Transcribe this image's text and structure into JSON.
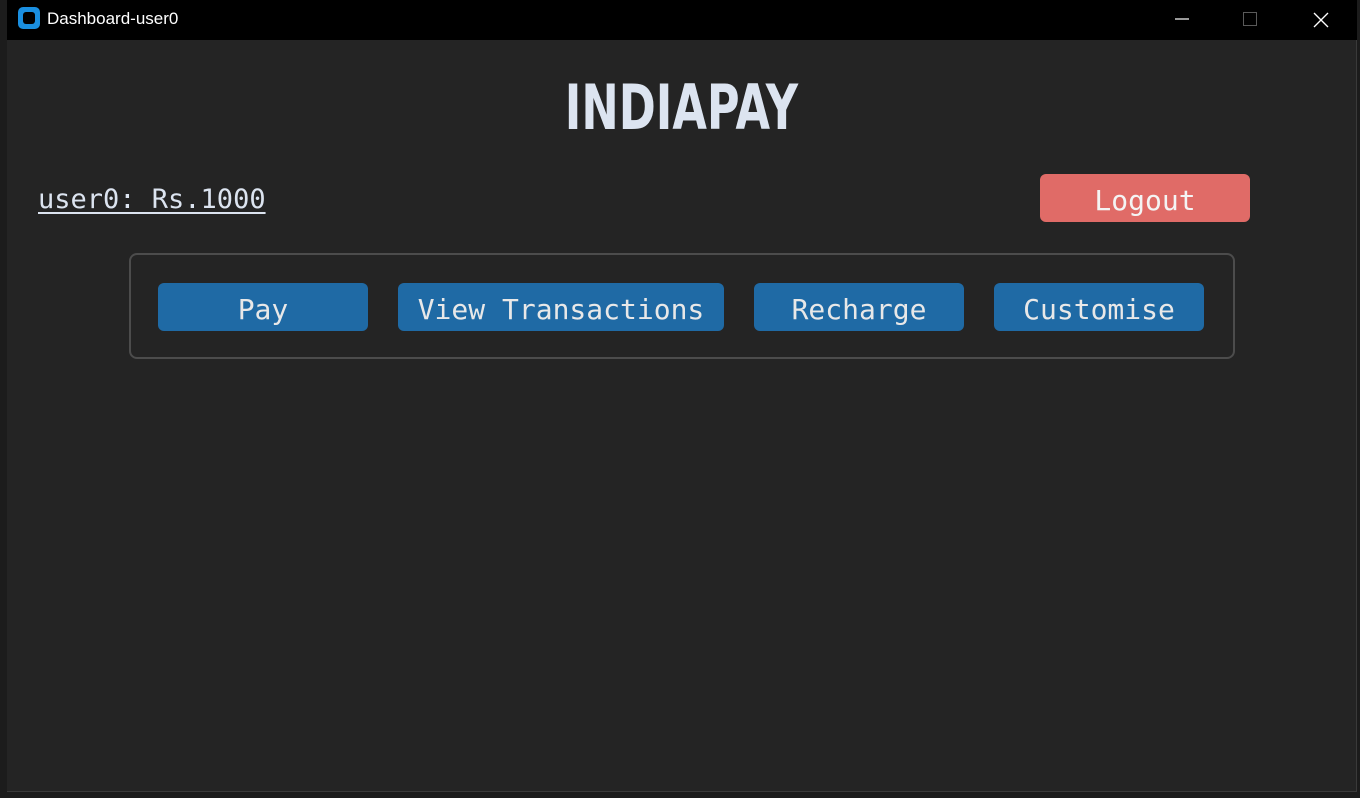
{
  "window": {
    "title": "Dashboard-user0",
    "icon": "app-icon",
    "controls": [
      "minimize-icon",
      "maximize-icon",
      "close-icon"
    ]
  },
  "header": {
    "brand": "INDIAPAY"
  },
  "account": {
    "balance_text": "user0: Rs.1000"
  },
  "actions": {
    "logout_label": "Logout",
    "pay_label": "Pay",
    "view_transactions_label": "View Transactions",
    "recharge_label": "Recharge",
    "customise_label": "Customise"
  },
  "colors": {
    "background": "#242424",
    "titlebar": "#000000",
    "primary_button": "#1f6aa5",
    "logout_button": "#e06b67",
    "text": "#dce4f0",
    "panel_border": "#4c4c4c"
  }
}
